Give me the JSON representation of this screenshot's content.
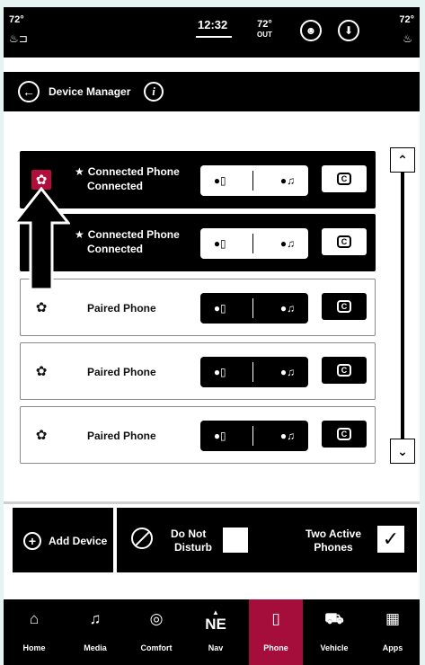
{
  "status_bar": {
    "left_temp": "72°",
    "time": "12:32",
    "out_temp": "72°",
    "out_label": "OUT",
    "right_temp": "72°",
    "left_icon": "seat-heat-icon",
    "right_icon": "seat-heat-icon"
  },
  "header": {
    "title": "Device Manager",
    "info_glyph": "i"
  },
  "devices": [
    {
      "name": "Connected Phone",
      "status": "Connected",
      "state": "connected",
      "selected_gear": true
    },
    {
      "name": "Connected Phone",
      "status": "Connected",
      "state": "connected",
      "selected_gear": false
    },
    {
      "name": "Paired Phone",
      "status": "",
      "state": "paired"
    },
    {
      "name": "Paired Phone",
      "status": "",
      "state": "paired"
    },
    {
      "name": "Paired Phone",
      "status": "",
      "state": "paired"
    }
  ],
  "profile_icons": {
    "phone": "phone-profile-icon",
    "music": "music-profile-icon",
    "carplay": "carplay-icon"
  },
  "actions": {
    "add_device": "Add Device",
    "dnd_line1": "Do Not",
    "dnd_line2": "Disturb",
    "dnd_checked": false,
    "two_line1": "Two Active",
    "two_line2": "Phones",
    "two_checked": true
  },
  "nav": [
    {
      "label": "Home",
      "icon": "home-icon",
      "active": false
    },
    {
      "label": "Media",
      "icon": "music-icon",
      "active": false
    },
    {
      "label": "Comfort",
      "icon": "climate-icon",
      "active": false
    },
    {
      "label": "Nav",
      "icon": "compass-icon",
      "heading": "NE",
      "active": false
    },
    {
      "label": "Phone",
      "icon": "phone-icon",
      "active": true
    },
    {
      "label": "Vehicle",
      "icon": "car-icon",
      "active": false
    },
    {
      "label": "Apps",
      "icon": "apps-grid-icon",
      "active": false
    }
  ],
  "colors": {
    "accent": "#a50d3a",
    "bar": "#000000"
  }
}
